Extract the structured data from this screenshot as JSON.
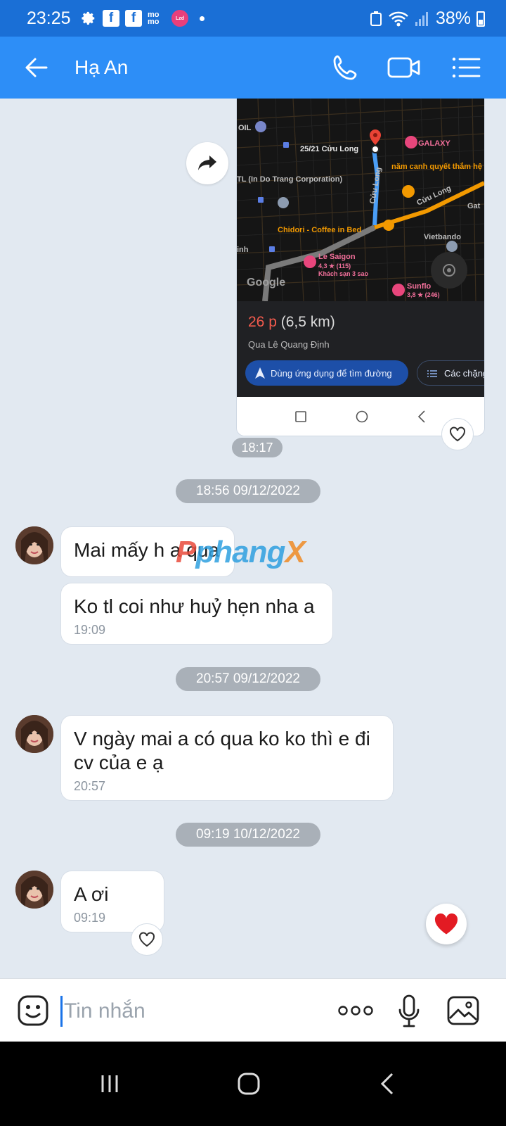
{
  "status_bar": {
    "time": "23:25",
    "notification_icons": [
      "gear-icon",
      "facebook-icon",
      "facebook-icon",
      "momo-icon",
      "lazada-icon"
    ],
    "momo_label": "mo mo",
    "lazada_label": "Lzd",
    "battery": "38%"
  },
  "header": {
    "contact_name": "Hạ An",
    "accent_color": "#2d8ef7"
  },
  "map_message": {
    "route_time": "26 p",
    "route_distance": "(6,5 km)",
    "route_via": "Qua Lê Quang Định",
    "directions_button": "Dùng ứng dụng để tìm đường",
    "steps_button": "Các chặng",
    "map_labels": {
      "oil": "OIL",
      "address": "25/21 Cửu Long",
      "galaxy": "GALAXY",
      "food": "năm canh quyết thắm hệ thống bò tơ tây ni",
      "corp": "TL (In Do Trang Corporation)",
      "street1": "Cửu Long",
      "street2": "Cửu Long",
      "cafe": "Chidori - Coffee in Bed",
      "vietbando": "Vietbando",
      "hotel_name": "Le Saigon",
      "hotel_rating": "4,3 ★ (115)",
      "hotel_desc": "Khách sạn 3 sao",
      "sunflower_name": "Sunflo",
      "sunflower_rating": "3,8 ★ (246)",
      "google": "Google",
      "gat": "Gat",
      "side": "inh"
    },
    "time": "18:17"
  },
  "messages": [
    {
      "divider": "18:56 09/12/2022"
    },
    {
      "text": "Mai mấy h a qua",
      "time": ""
    },
    {
      "text": "Ko tl coi như huỷ hẹn nha a",
      "time": "19:09"
    },
    {
      "divider": "20:57 09/12/2022"
    },
    {
      "text": "V ngày mai a có qua ko ko thì e đi cv của e ạ",
      "time": "20:57"
    },
    {
      "divider": "09:19 10/12/2022"
    },
    {
      "text": "A ơi",
      "time": "09:19"
    }
  ],
  "watermark": {
    "part1": "P",
    "part2": "phang",
    "part3": "X"
  },
  "input": {
    "placeholder": "Tin nhắn"
  }
}
